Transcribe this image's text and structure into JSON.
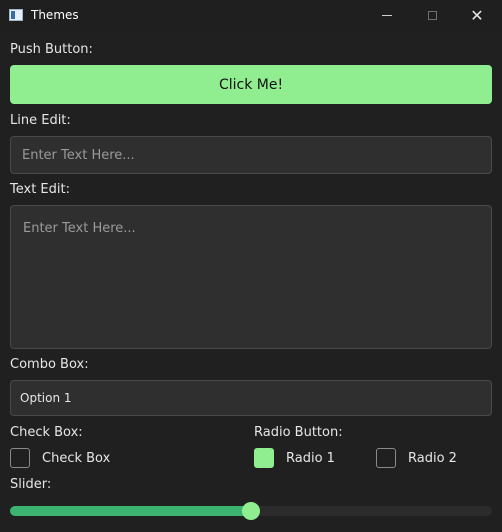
{
  "window": {
    "title": "Themes"
  },
  "labels": {
    "push_button": "Push Button:",
    "line_edit": "Line Edit:",
    "text_edit": "Text Edit:",
    "combo_box": "Combo Box:",
    "check_box": "Check Box:",
    "radio_button": "Radio Button:",
    "slider": "Slider:"
  },
  "push_button": {
    "text": "Click Me!",
    "bg_color": "#90ee90"
  },
  "line_edit": {
    "placeholder": "Enter Text Here..."
  },
  "text_edit": {
    "placeholder": "Enter Text Here..."
  },
  "combo_box": {
    "selected": "Option 1"
  },
  "check_box": {
    "label": "Check Box",
    "checked": false
  },
  "radios": [
    {
      "label": "Radio 1",
      "checked": true
    },
    {
      "label": "Radio 2",
      "checked": false
    }
  ],
  "slider": {
    "value_fraction": 0.5,
    "accent": "#3cb371",
    "handle_color": "#90ee90"
  },
  "icons": {
    "app": "app-window-icon",
    "minimize": "minimize-icon",
    "maximize": "maximize-icon",
    "close": "close-icon"
  }
}
